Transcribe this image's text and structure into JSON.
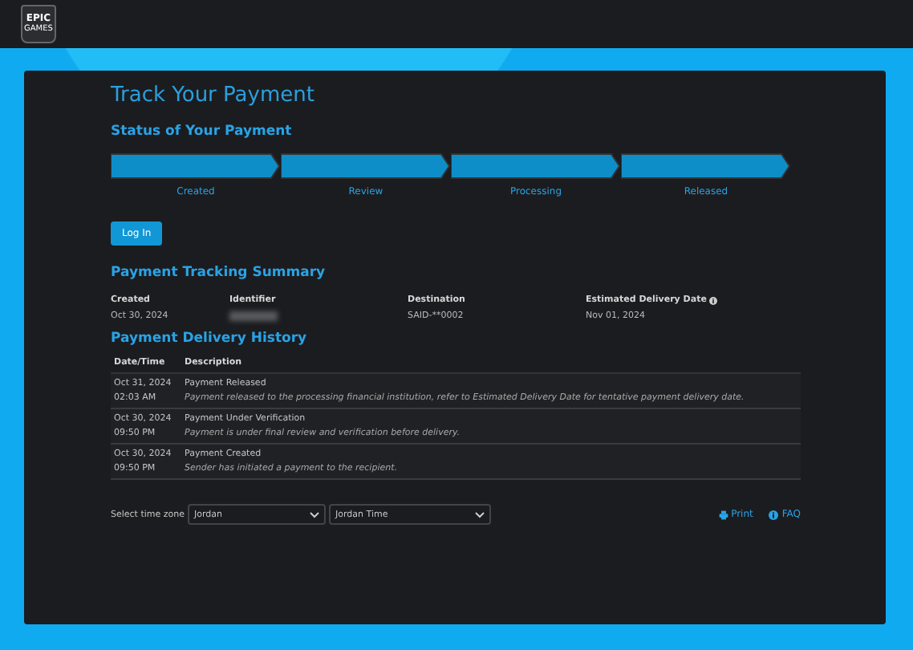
{
  "header": {
    "logo_top": "EPIC",
    "logo_bottom": "GAMES"
  },
  "title": "Track Your Payment",
  "status": {
    "heading": "Status of Your Payment",
    "steps": [
      {
        "label": "Created",
        "completed": true
      },
      {
        "label": "Review",
        "completed": true
      },
      {
        "label": "Processing",
        "completed": true
      },
      {
        "label": "Released",
        "completed": true
      }
    ]
  },
  "login_button": "Log In",
  "summary": {
    "heading": "Payment Tracking Summary",
    "fields": [
      {
        "label": "Created",
        "value": "Oct 30, 2024",
        "kind": "text",
        "info": false
      },
      {
        "label": "Identifier",
        "kind": "redacted",
        "info": false
      },
      {
        "label": "Destination",
        "value": "SAID-**0002",
        "kind": "text",
        "info": false
      },
      {
        "label": "Estimated Delivery Date",
        "value": "Nov 01, 2024",
        "kind": "text",
        "info": true
      }
    ]
  },
  "history": {
    "heading": "Payment Delivery History",
    "columns": [
      "Date/Time",
      "Description"
    ],
    "rows": [
      {
        "date": "Oct 31, 2024",
        "time": "02:03 AM",
        "title": "Payment Released",
        "detail": "Payment released to the processing financial institution, refer to Estimated Delivery Date for tentative payment delivery date."
      },
      {
        "date": "Oct 30, 2024",
        "time": "09:50 PM",
        "title": "Payment Under Verification",
        "detail": "Payment is under final review and verification before delivery."
      },
      {
        "date": "Oct 30, 2024",
        "time": "09:50 PM",
        "title": "Payment Created",
        "detail": "Sender has initiated a payment to the recipient."
      }
    ]
  },
  "footer": {
    "timezone_label": "Select time zone",
    "country": "Jordan",
    "zone": "Jordan Time",
    "print": "Print",
    "faq": "FAQ"
  }
}
